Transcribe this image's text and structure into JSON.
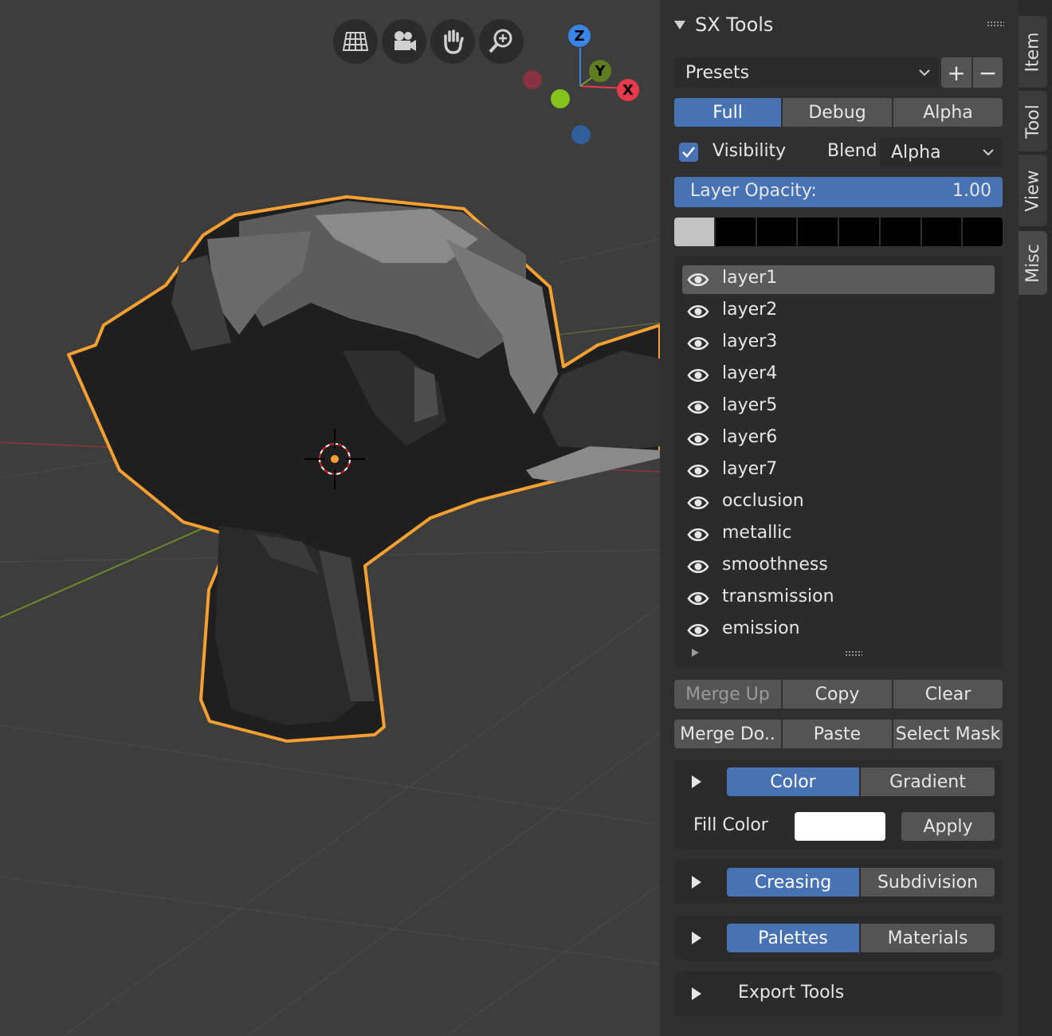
{
  "panel": {
    "title": "SX Tools",
    "presets": {
      "label": "Presets",
      "add": "+",
      "remove": "−"
    },
    "modes": [
      "Full",
      "Debug",
      "Alpha"
    ],
    "active_mode": "Full",
    "visibility": {
      "label": "Visibility",
      "checked": true
    },
    "blend": {
      "label": "Blend",
      "value": "Alpha"
    },
    "opacity": {
      "label": "Layer Opacity:",
      "value": "1.00",
      "fraction": 1.0
    },
    "palette_swatches": [
      "#c2c2c2",
      "#000000",
      "#000000",
      "#000000",
      "#000000",
      "#000000",
      "#000000",
      "#000000"
    ],
    "layers": [
      "layer1",
      "layer2",
      "layer3",
      "layer4",
      "layer5",
      "layer6",
      "layer7",
      "occlusion",
      "metallic",
      "smoothness",
      "transmission",
      "emission"
    ],
    "selected_layer": "layer1",
    "layer_actions_row1": [
      "Merge Up",
      "Copy",
      "Clear"
    ],
    "layer_actions_row2": [
      "Merge Do..",
      "Paste",
      "Select Mask"
    ],
    "color_section": {
      "tabs": [
        "Color",
        "Gradient"
      ],
      "active": "Color",
      "fill_label": "Fill Color",
      "fill_color": "#ffffff",
      "apply": "Apply"
    },
    "crease_section": {
      "tabs": [
        "Creasing",
        "Subdivision"
      ],
      "active": "Creasing"
    },
    "palette_section": {
      "tabs": [
        "Palettes",
        "Materials"
      ],
      "active": "Palettes"
    },
    "export_section": {
      "label": "Export Tools"
    }
  },
  "side_tabs": [
    "Item",
    "Tool",
    "View",
    "Misc"
  ],
  "active_side_tab": "Misc",
  "gizmo": {
    "z": "Z",
    "y": "Y",
    "x": "X"
  },
  "colors": {
    "accent": "#4772b3",
    "selection_outline": "#f5a030",
    "panel_bg": "#303030"
  }
}
